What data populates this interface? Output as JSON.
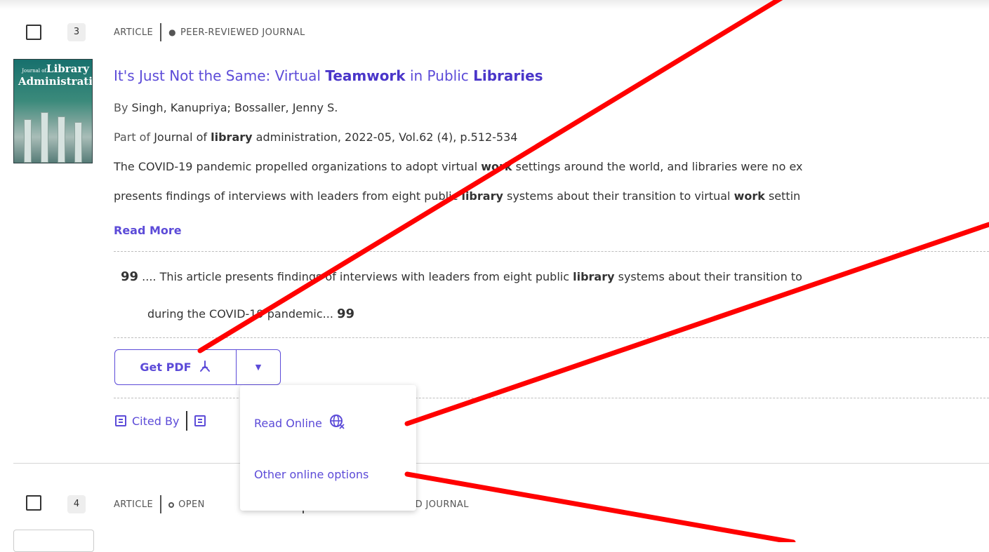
{
  "result1": {
    "index": "3",
    "type_label": "ARTICLE",
    "peer_label": "PEER-REVIEWED JOURNAL",
    "thumb_small": "Journal of",
    "thumb_big1": "Library",
    "thumb_big2": "Administration",
    "title_a": "It's Just Not the Same: Virtual ",
    "title_b": "Teamwork",
    "title_c": " in Public ",
    "title_d": "Libraries",
    "by_prefix": "By ",
    "authors": "Singh, Kanupriya; Bossaller, Jenny S.",
    "part_prefix": "Part of ",
    "journal_a": "Journal of ",
    "journal_b": "library",
    "journal_c": " administration, 2022-05, Vol.62 (4), p.512-534",
    "abs1_a": "The COVID-19 pandemic propelled organizations to adopt virtual ",
    "abs1_b": "work",
    "abs1_c": " settings around the world, and libraries were no ex",
    "abs2_a": "presents findings of interviews with leaders from eight public ",
    "abs2_b": "library",
    "abs2_c": " systems about their transition to virtual ",
    "abs2_d": "work",
    "abs2_e": " settin",
    "read_more": "Read More",
    "quote_mark": "99",
    "snip1_a": ".... This article presents findings of interviews with leaders from eight public ",
    "snip1_b": "library",
    "snip1_c": " systems about their transition to",
    "snip2": "during the COVID-19 pandemic...",
    "get_pdf": "Get PDF",
    "cited_by": "Cited By"
  },
  "dropdown": {
    "read_online": "Read Online",
    "other_options": "Other online options"
  },
  "result2": {
    "index": "4",
    "type_label": "ARTICLE",
    "open_label": "OPEN",
    "peer_tail": "ED JOURNAL"
  },
  "colors": {
    "accent": "#5c4bd8",
    "annotation": "#ff0000"
  },
  "icons": [
    "eye-icon",
    "pdf-icon",
    "caret-down-icon",
    "citation-icon",
    "globe-icon",
    "open-access-icon"
  ]
}
